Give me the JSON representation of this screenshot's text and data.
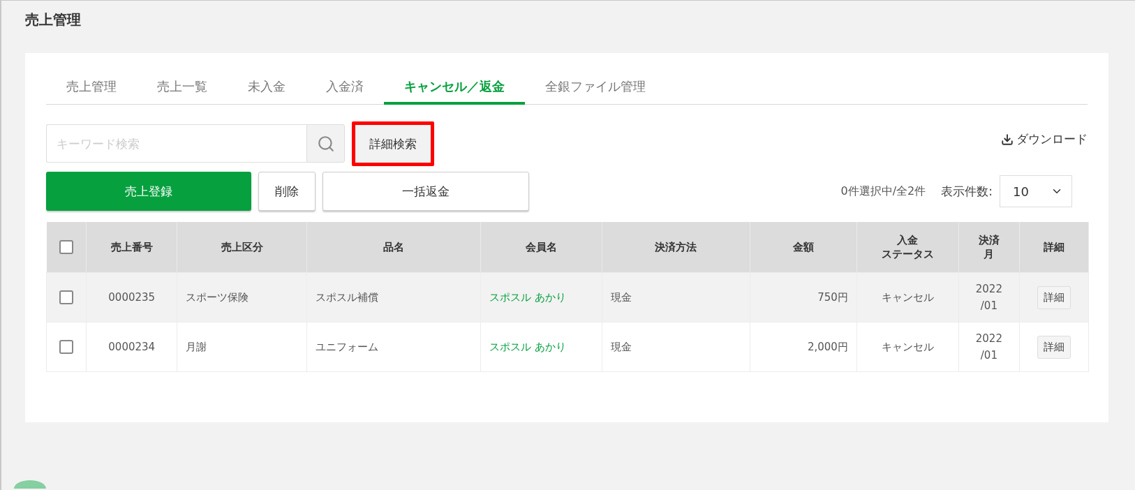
{
  "page_title": "売上管理",
  "tabs": [
    {
      "label": "売上管理",
      "selected": false
    },
    {
      "label": "売上一覧",
      "selected": false
    },
    {
      "label": "未入金",
      "selected": false
    },
    {
      "label": "入金済",
      "selected": false
    },
    {
      "label": "キャンセル／返金",
      "selected": true
    },
    {
      "label": "全銀ファイル管理",
      "selected": false
    }
  ],
  "search": {
    "placeholder": "キーワード検索"
  },
  "detail_search": {
    "label": "詳細検索",
    "highlighted": true
  },
  "download": {
    "label": "ダウンロード"
  },
  "actions": [
    {
      "label": "売上登録",
      "kind": "primary"
    },
    {
      "label": "削除",
      "kind": "small"
    },
    {
      "label": "一括返金",
      "kind": "wide"
    }
  ],
  "selection_count": "0件選択中/全2件",
  "page_size": {
    "label": "表示件数:",
    "value": "10"
  },
  "table": {
    "select_all_checked": false,
    "columns": [
      {
        "lines": [
          "売上番号"
        ]
      },
      {
        "lines": [
          "売上区分"
        ]
      },
      {
        "lines": [
          "品名"
        ]
      },
      {
        "lines": [
          "会員名"
        ]
      },
      {
        "lines": [
          "決済方法"
        ]
      },
      {
        "lines": [
          "金額"
        ]
      },
      {
        "lines": [
          "入金",
          "ステータス"
        ]
      },
      {
        "lines": [
          "決済",
          "月"
        ]
      },
      {
        "lines": [
          "詳細"
        ]
      }
    ],
    "rows": [
      {
        "checked": false,
        "cells": [
          "0000235",
          "スポーツ保険",
          "スポスル補償",
          "スポスル あかり",
          "現金",
          "750円",
          "キャンセル",
          "2022\n/01"
        ],
        "action": "詳細"
      },
      {
        "checked": false,
        "cells": [
          "0000234",
          "月謝",
          "ユニフォーム",
          "スポスル あかり",
          "現金",
          "2,000円",
          "キャンセル",
          "2022\n/01"
        ],
        "action": "詳細"
      }
    ]
  }
}
